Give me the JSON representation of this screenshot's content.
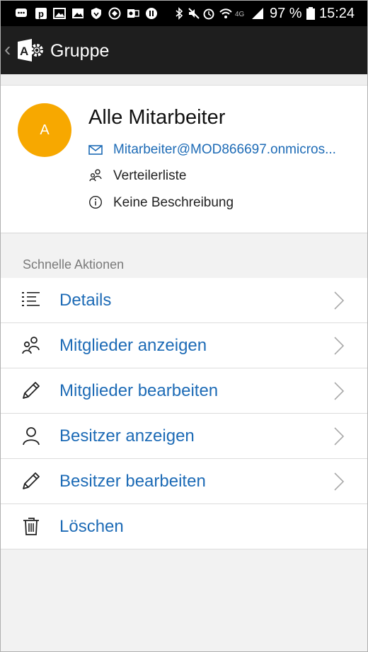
{
  "status_bar": {
    "battery": "97 %",
    "time": "15:24",
    "network": "4G"
  },
  "app_bar": {
    "back_glyph": "‹",
    "title": "Gruppe"
  },
  "group": {
    "avatar_letter": "A",
    "avatar_color": "#f7a800",
    "name": "Alle Mitarbeiter",
    "email": "Mitarbeiter@MOD866697.onmicros...",
    "type": "Verteilerliste",
    "description": "Keine Beschreibung"
  },
  "quick_actions": {
    "label": "Schnelle Aktionen",
    "items": [
      {
        "label": "Details",
        "icon": "list-icon",
        "chevron": true
      },
      {
        "label": "Mitglieder anzeigen",
        "icon": "people-icon",
        "chevron": true
      },
      {
        "label": "Mitglieder bearbeiten",
        "icon": "pencil-icon",
        "chevron": true
      },
      {
        "label": "Besitzer anzeigen",
        "icon": "person-icon",
        "chevron": true
      },
      {
        "label": "Besitzer bearbeiten",
        "icon": "pencil-icon",
        "chevron": true
      },
      {
        "label": "Löschen",
        "icon": "trash-icon",
        "chevron": false
      }
    ]
  },
  "colors": {
    "accent": "#1d6bb6",
    "appbar": "#1e1e1e"
  }
}
